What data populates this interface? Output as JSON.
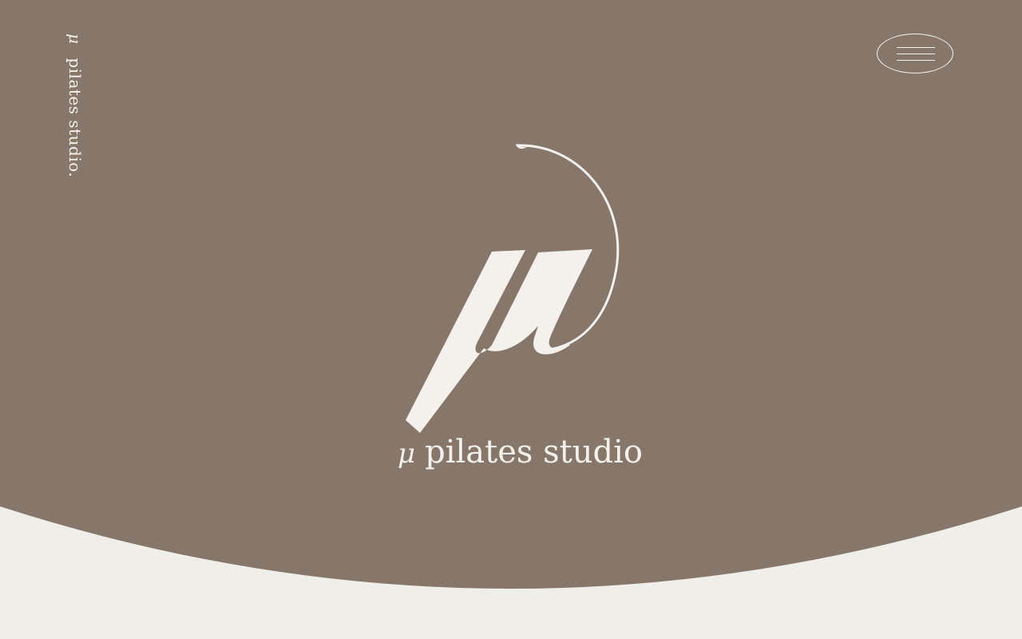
{
  "colors": {
    "hero_background": "#86776a",
    "page_background": "#f0eee9",
    "foreground": "#f4f1ec"
  },
  "side_brand": {
    "symbol": "μ",
    "text": "pilates studio."
  },
  "menu_button": {
    "icon": "hamburger-menu-icon"
  },
  "logo": {
    "mark_icon": "mu-logo-mark",
    "wordmark_symbol": "μ",
    "wordmark_text": "pilates studio"
  }
}
